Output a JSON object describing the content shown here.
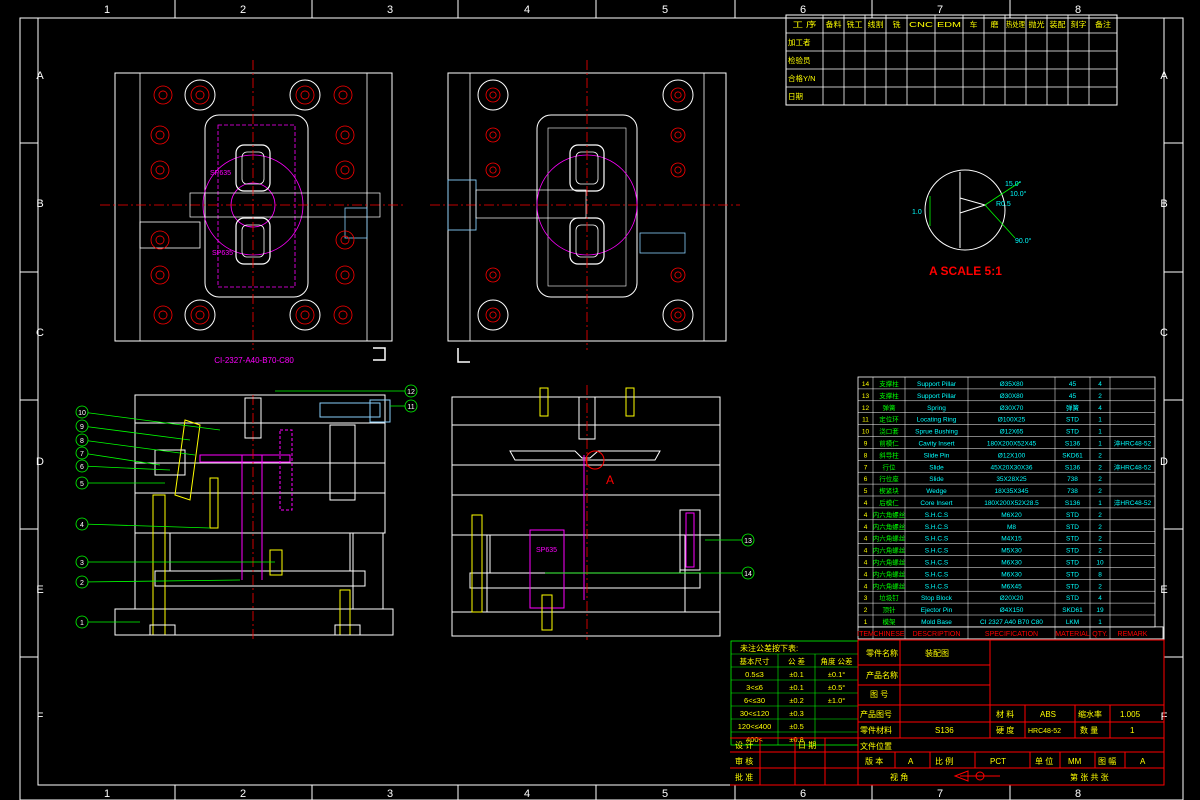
{
  "grid": {
    "cols": [
      "1",
      "2",
      "3",
      "4",
      "5",
      "6",
      "7",
      "8"
    ],
    "rows": [
      "A",
      "B",
      "C",
      "D",
      "E",
      "F"
    ]
  },
  "colors": {
    "background": "#000000",
    "frame": "#ffffff",
    "plate": "#ffffff",
    "center_line": "#ff0000",
    "pin": "#ff00ff",
    "highlight": "#ffff00",
    "leader": "#00ff00",
    "dimension": "#00ffff",
    "side_parts": "#87cefa"
  },
  "process_table": {
    "headers": [
      "工 序",
      "备料",
      "铣工",
      "线割",
      "铣",
      "CNC",
      "EDM",
      "车",
      "磨",
      "热处理",
      "抛光",
      "装配",
      "刻字",
      "备注"
    ],
    "rows": [
      "加工者",
      "检验员",
      "合格Y/N",
      "日期"
    ]
  },
  "mold_code": "CI-2327-A40-B70-C80",
  "detail": {
    "label": "A",
    "title": "A SCALE 5:1",
    "dims": [
      "15.0°",
      "10.0°",
      "R0.5",
      "1.0",
      "90.0°"
    ]
  },
  "balloons": {
    "front_view": [
      "10",
      "9",
      "8",
      "7",
      "6",
      "5",
      "4",
      "3",
      "2",
      "1"
    ],
    "top_right": [
      "12",
      "11"
    ],
    "right_view": [
      "13",
      "14"
    ]
  },
  "sp_label": "SP635",
  "bom": {
    "rows": [
      [
        "14",
        "支撑柱",
        "Support Pillar",
        "Ø35X80",
        "45",
        "4",
        ""
      ],
      [
        "13",
        "支撑柱",
        "Support Pillar",
        "Ø30X80",
        "45",
        "2",
        ""
      ],
      [
        "12",
        "弹簧",
        "Spring",
        "Ø30X70",
        "弹簧",
        "4",
        ""
      ],
      [
        "11",
        "定位环",
        "Locating Ring",
        "Ø100X25",
        "STD",
        "1",
        ""
      ],
      [
        "10",
        "浇口套",
        "Sprue Bushing",
        "Ø12X65",
        "STD",
        "1",
        ""
      ],
      [
        "9",
        "前模仁",
        "Cavity Insert",
        "180X200X52X45",
        "S136",
        "1",
        "淬HRC48-52"
      ],
      [
        "8",
        "斜导柱",
        "Slide Pin",
        "Ø12X100",
        "SKD61",
        "2",
        ""
      ],
      [
        "7",
        "行位",
        "Slide",
        "45X20X30X36",
        "S136",
        "2",
        "淬HRC48-52"
      ],
      [
        "6",
        "行位座",
        "Slide",
        "35X28X25",
        "738",
        "2",
        ""
      ],
      [
        "5",
        "楔紧块",
        "Wedge",
        "18X35X345",
        "738",
        "2",
        ""
      ],
      [
        "4",
        "后模仁",
        "Core Insert",
        "180X200X52X28.5",
        "S136",
        "1",
        "淬HRC48-52"
      ],
      [
        "4",
        "内六角螺丝",
        "S.H.C.S",
        "M6X20",
        "STD",
        "2",
        ""
      ],
      [
        "4",
        "内六角螺丝",
        "S.H.C.S",
        "M8",
        "STD",
        "2",
        ""
      ],
      [
        "4",
        "内六角螺丝",
        "S.H.C.S",
        "M4X15",
        "STD",
        "2",
        ""
      ],
      [
        "4",
        "内六角螺丝",
        "S.H.C.S",
        "M5X30",
        "STD",
        "2",
        ""
      ],
      [
        "4",
        "内六角螺丝",
        "S.H.C.S",
        "M6X30",
        "STD",
        "10",
        ""
      ],
      [
        "4",
        "内六角螺丝",
        "S.H.C.S",
        "M6X30",
        "STD",
        "8",
        ""
      ],
      [
        "4",
        "内六角螺丝",
        "S.H.C.S",
        "M6X45",
        "STD",
        "2",
        ""
      ],
      [
        "3",
        "垃圾钉",
        "Stop Block",
        "Ø20X20",
        "STD",
        "4",
        ""
      ],
      [
        "2",
        "顶针",
        "Ejector Pin",
        "Ø4X150",
        "SKD61",
        "19",
        ""
      ],
      [
        "1",
        "模架",
        "Mold Base",
        "CI 2327 A40 B70 C80",
        "LKM",
        "1",
        ""
      ]
    ],
    "headers": [
      "ITEM",
      "CHINESE",
      "DESCRIPTION",
      "SPECIFICATION",
      "MATERIAL",
      "QTY.",
      "REMARK"
    ]
  },
  "tolerance": {
    "title": "未注公差按下表:",
    "headers": [
      "基本尺寸",
      "公 差",
      "角度 公差"
    ],
    "rows": [
      [
        "0.5≤3",
        "±0.1",
        "±0.1°"
      ],
      [
        "3<≤6",
        "±0.1",
        "±0.5°"
      ],
      [
        "6<≤30",
        "±0.2",
        "±1.0°"
      ],
      [
        "30<≤120",
        "±0.3",
        ""
      ],
      [
        "120<≤400",
        "±0.5",
        ""
      ],
      [
        "400<",
        "±0.8",
        ""
      ]
    ]
  },
  "title_block": {
    "part_name_label": "零件名称",
    "part_name_value": "装配图",
    "product_name_label": "产品名称",
    "drawing_no_label": "图 号",
    "product_no_label": "产品图号",
    "part_material_label": "零件材料",
    "part_material_value": "S136",
    "file_location_label": "文件位置",
    "material_label": "材 料",
    "material_value": "ABS",
    "shrink_label": "缩水率",
    "shrink_value": "1.005",
    "hardness_label": "硬 度",
    "hardness_value": "HRC48-52",
    "quantity_label": "数 量",
    "quantity_value": "1",
    "designer_label": "设 计",
    "date_label": "日 期",
    "checker_label": "审 核",
    "approver_label": "批 准",
    "version_label": "版 本",
    "version_value": "A",
    "scale_label": "比 例",
    "scale_value": "PCT",
    "unit_label": "单 位",
    "unit_value": "MM",
    "sheet_label": "图 幅",
    "sheet_value": "A",
    "view_label": "视 角",
    "sheets_label": "第 张 共 张"
  }
}
